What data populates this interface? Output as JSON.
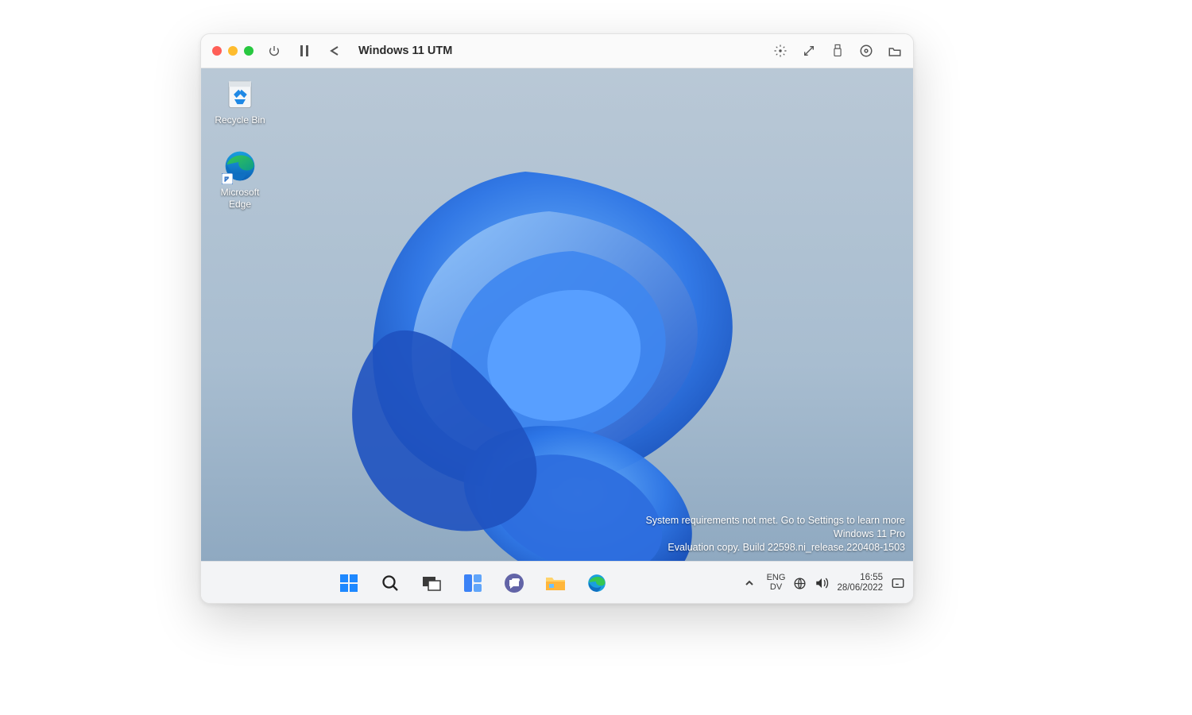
{
  "host_titlebar": {
    "title": "Windows 11 UTM"
  },
  "desktop": {
    "icons": [
      {
        "label": "Recycle Bin"
      },
      {
        "label": "Microsoft\nEdge"
      }
    ],
    "watermark": {
      "line1": "System requirements not met. Go to Settings to learn more",
      "line2": "Windows 11 Pro",
      "line3": "Evaluation copy. Build 22598.ni_release.220408-1503"
    }
  },
  "taskbar": {
    "lang_line1": "ENG",
    "lang_line2": "DV",
    "time": "16:55",
    "date": "28/06/2022"
  }
}
